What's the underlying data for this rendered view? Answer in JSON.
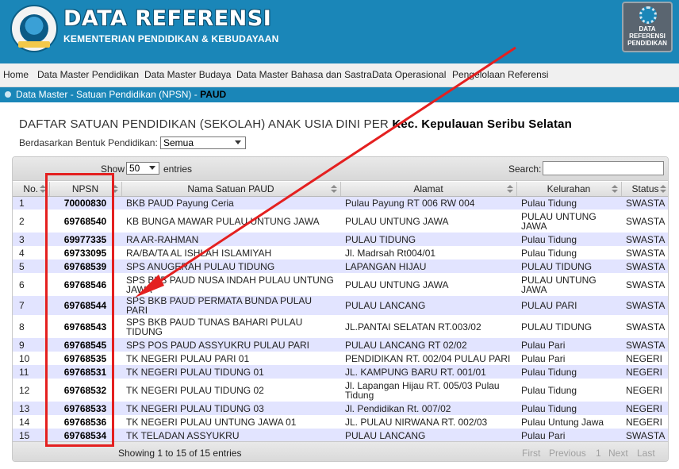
{
  "header": {
    "title": "DATA REFERENSI",
    "subtitle": "KEMENTERIAN PENDIDIKAN & KEBUDAYAAN",
    "badge_lines": [
      "DATA",
      "REFERENSI",
      "PENDIDIKAN"
    ]
  },
  "nav": {
    "items": [
      "Home",
      "Data Master Pendidikan",
      "Data Master Budaya",
      "Data Master Bahasa dan Sastra",
      "Data Operasional",
      "Pengelolaan Referensi"
    ]
  },
  "breadcrumb": {
    "path": "Data Master - Satuan Pendidikan (NPSN) - ",
    "current": "PAUD"
  },
  "page": {
    "title_prefix": "DAFTAR SATUAN PENDIDIKAN (SEKOLAH) ANAK USIA DINI PER ",
    "title_bold": "Kec. Kepulauan Seribu Selatan",
    "filter_label": "Berdasarkan Bentuk Pendidikan:",
    "filter_value": "Semua"
  },
  "table": {
    "show_label": "Show",
    "length_value": "50",
    "entries_label": "entries",
    "search_label": "Search:",
    "columns": [
      "No.",
      "NPSN",
      "Nama Satuan PAUD",
      "Alamat",
      "Kelurahan",
      "Status"
    ],
    "rows": [
      {
        "no": "1",
        "npsn": "70000830",
        "nama": "BKB PAUD Payung Ceria",
        "alamat": "Pulau Payung RT 006 RW 004",
        "kelurahan": "Pulau Tidung",
        "status": "SWASTA"
      },
      {
        "no": "2",
        "npsn": "69768540",
        "nama": "KB BUNGA MAWAR PULAU UNTUNG JAWA",
        "alamat": "PULAU UNTUNG JAWA",
        "kelurahan": "PULAU UNTUNG JAWA",
        "status": "SWASTA"
      },
      {
        "no": "3",
        "npsn": "69977335",
        "nama": "RA AR-RAHMAN",
        "alamat": "PULAU TIDUNG",
        "kelurahan": "Pulau Tidung",
        "status": "SWASTA"
      },
      {
        "no": "4",
        "npsn": "69733095",
        "nama": "RA/BA/TA AL ISHLAH ISLAMIYAH",
        "alamat": "Jl. Madrsah Rt004/01",
        "kelurahan": "Pulau Tidung",
        "status": "SWASTA"
      },
      {
        "no": "5",
        "npsn": "69768539",
        "nama": "SPS ANUGERAH PULAU TIDUNG",
        "alamat": "LAPANGAN HIJAU",
        "kelurahan": "PULAU TIDUNG",
        "status": "SWASTA"
      },
      {
        "no": "6",
        "npsn": "69768546",
        "nama": "SPS BKB PAUD NUSA INDAH PULAU UNTUNG JAWA",
        "alamat": "PULAU UNTUNG JAWA",
        "kelurahan": "PULAU UNTUNG JAWA",
        "status": "SWASTA"
      },
      {
        "no": "7",
        "npsn": "69768544",
        "nama": "SPS BKB PAUD PERMATA BUNDA PULAU PARI",
        "alamat": "PULAU LANCANG",
        "kelurahan": "PULAU PARI",
        "status": "SWASTA"
      },
      {
        "no": "8",
        "npsn": "69768543",
        "nama": "SPS BKB PAUD TUNAS BAHARI PULAU TIDUNG",
        "alamat": "JL.PANTAI SELATAN RT.003/02",
        "kelurahan": "PULAU TIDUNG",
        "status": "SWASTA"
      },
      {
        "no": "9",
        "npsn": "69768545",
        "nama": "SPS POS PAUD ASSYUKRU PULAU PARI",
        "alamat": "PULAU LANCANG RT 02/02",
        "kelurahan": "Pulau Pari",
        "status": "SWASTA"
      },
      {
        "no": "10",
        "npsn": "69768535",
        "nama": "TK NEGERI PULAU PARI 01",
        "alamat": "PENDIDIKAN RT. 002/04 PULAU PARI",
        "kelurahan": "Pulau Pari",
        "status": "NEGERI"
      },
      {
        "no": "11",
        "npsn": "69768531",
        "nama": "TK NEGERI PULAU TIDUNG 01",
        "alamat": "JL. KAMPUNG BARU RT. 001/01",
        "kelurahan": "Pulau Tidung",
        "status": "NEGERI"
      },
      {
        "no": "12",
        "npsn": "69768532",
        "nama": "TK NEGERI PULAU TIDUNG 02",
        "alamat": "Jl. Lapangan Hijau RT. 005/03 Pulau Tidung",
        "kelurahan": "Pulau Tidung",
        "status": "NEGERI"
      },
      {
        "no": "13",
        "npsn": "69768533",
        "nama": "TK NEGERI PULAU TIDUNG 03",
        "alamat": "Jl. Pendidikan Rt. 007/02",
        "kelurahan": "Pulau Tidung",
        "status": "NEGERI"
      },
      {
        "no": "14",
        "npsn": "69768536",
        "nama": "TK NEGERI PULAU UNTUNG JAWA 01",
        "alamat": "JL. PULAU NIRWANA RT. 002/03",
        "kelurahan": "Pulau Untung Jawa",
        "status": "NEGERI"
      },
      {
        "no": "15",
        "npsn": "69768534",
        "nama": "TK TELADAN ASSYUKRU",
        "alamat": "PULAU LANCANG",
        "kelurahan": "Pulau Pari",
        "status": "SWASTA"
      }
    ],
    "info": "Showing 1 to 15 of 15 entries",
    "pagination": {
      "first": "First",
      "previous": "Previous",
      "page": "1",
      "next": "Next",
      "last": "Last"
    }
  },
  "annotation": {
    "color": "#e42020"
  }
}
